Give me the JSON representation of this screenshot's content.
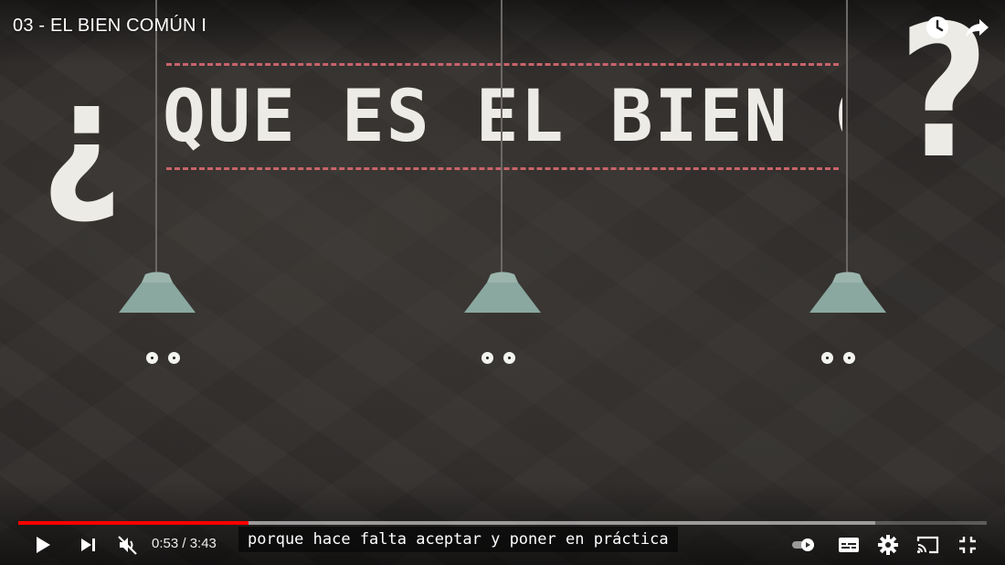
{
  "video": {
    "title": "03 - EL BIEN COMÚN I",
    "heading": "QUE ES EL BIEN COMUN",
    "open_question_mark": "¿",
    "close_question_mark": "?"
  },
  "subtitle": "porque hace falta aceptar y poner en práctica",
  "player": {
    "current_time": "0:53",
    "duration": "3:43",
    "time_display": "0:53 / 3:43",
    "progress_fraction": 0.238,
    "buffered_fraction": 0.885
  },
  "colors": {
    "progress": "#ff0000",
    "dash": "#c8646a",
    "lamp": "#8aa8a0"
  },
  "icons": {
    "top_right": [
      "watch-later-icon",
      "share-icon"
    ],
    "left_controls": [
      "play-icon",
      "next-icon",
      "mute-icon"
    ],
    "right_controls": [
      "autoplay-toggle-icon",
      "subtitles-icon",
      "settings-icon",
      "cast-icon",
      "exit-fullscreen-icon"
    ]
  }
}
